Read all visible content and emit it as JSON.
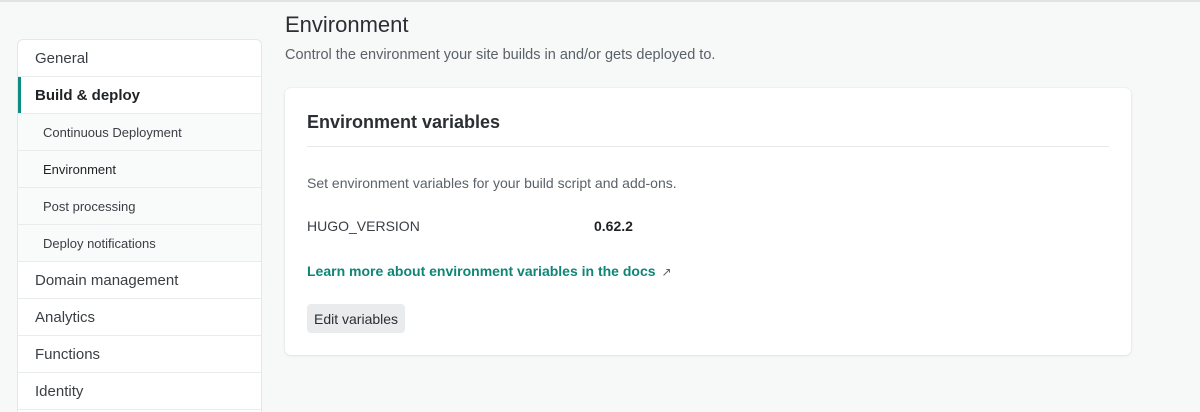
{
  "sidebar": {
    "items": [
      {
        "label": "General"
      },
      {
        "label": "Build & deploy"
      },
      {
        "label": "Domain management"
      },
      {
        "label": "Analytics"
      },
      {
        "label": "Functions"
      },
      {
        "label": "Identity"
      }
    ],
    "subitems": [
      {
        "label": "Continuous Deployment"
      },
      {
        "label": "Environment"
      },
      {
        "label": "Post processing"
      },
      {
        "label": "Deploy notifications"
      }
    ]
  },
  "page": {
    "title": "Environment",
    "description": "Control the environment your site builds in and/or gets deployed to."
  },
  "card": {
    "title": "Environment variables",
    "description": "Set environment variables for your build script and add-ons.",
    "variables": [
      {
        "key": "HUGO_VERSION",
        "value": "0.62.2"
      }
    ],
    "docs_link": "Learn more about environment variables in the docs",
    "docs_link_icon": "↗",
    "edit_button": "Edit variables"
  },
  "colors": {
    "accent": "#0e8c7f",
    "link": "#0e8576",
    "background": "#f7f8f8"
  }
}
